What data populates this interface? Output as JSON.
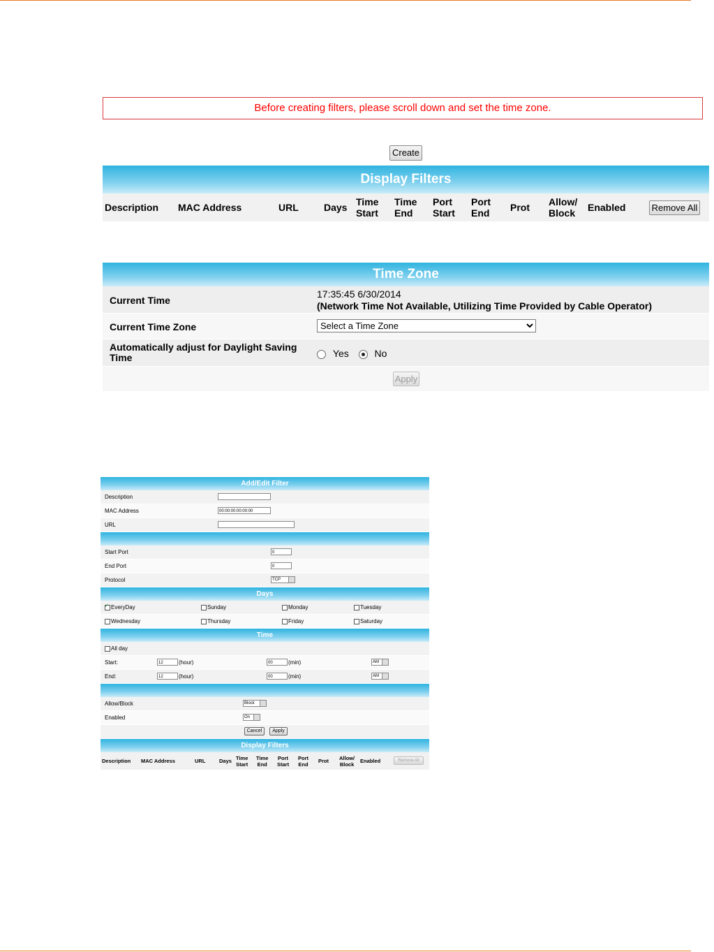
{
  "warning": "Before creating filters, please scroll down and set the time zone.",
  "create_label": "Create",
  "display_filters": {
    "title": "Display Filters",
    "columns": [
      {
        "l1": "Description",
        "l2": ""
      },
      {
        "l1": "MAC Address",
        "l2": ""
      },
      {
        "l1": "URL",
        "l2": ""
      },
      {
        "l1": "Days",
        "l2": ""
      },
      {
        "l1": "Time",
        "l2": "Start"
      },
      {
        "l1": "Time",
        "l2": "End"
      },
      {
        "l1": "Port",
        "l2": "Start"
      },
      {
        "l1": "Port",
        "l2": "End"
      },
      {
        "l1": "Prot",
        "l2": ""
      },
      {
        "l1": "Allow/",
        "l2": "Block"
      },
      {
        "l1": "Enabled",
        "l2": ""
      }
    ],
    "remove_all_label": "Remove All"
  },
  "time_zone": {
    "title": "Time Zone",
    "current_time_label": "Current Time",
    "current_time_value": "17:35:45 6/30/2014",
    "current_time_note": "(Network Time Not Available, Utilizing Time Provided by Cable Operator)",
    "current_zone_label": "Current Time Zone",
    "zone_select_value": "Select a Time Zone",
    "dst_label": "Automatically adjust for Daylight Saving Time",
    "dst_yes": "Yes",
    "dst_no": "No",
    "dst_selected": "No",
    "apply_label": "Apply"
  },
  "mini": {
    "add_edit_title": "Add/Edit Filter",
    "description_label": "Description",
    "mac_label": "MAC Address",
    "mac_value": "00:00:00:00:00:00",
    "url_label": "URL",
    "start_port_label": "Start Port",
    "start_port_value": "0",
    "end_port_label": "End Port",
    "end_port_value": "0",
    "protocol_label": "Protocol",
    "protocol_value": "TCP",
    "days_title": "Days",
    "days": [
      {
        "label": "EveryDay",
        "checked": true
      },
      {
        "label": "Sunday",
        "checked": false
      },
      {
        "label": "Monday",
        "checked": false
      },
      {
        "label": "Tuesday",
        "checked": false
      },
      {
        "label": "Wednesday",
        "checked": false
      },
      {
        "label": "Thursday",
        "checked": false
      },
      {
        "label": "Friday",
        "checked": false
      },
      {
        "label": "Saturday",
        "checked": false
      }
    ],
    "time_title": "Time",
    "all_day_label": "All day",
    "start_label": "Start:",
    "end_label": "End:",
    "hour_value": "12",
    "hour_unit": "(hour)",
    "min_value": "00",
    "min_unit": "(min)",
    "ampm_value": "AM",
    "allow_block_label": "Allow/Block",
    "allow_block_value": "Block",
    "enabled_label": "Enabled",
    "enabled_value": "On",
    "cancel_label": "Cancel",
    "apply_label": "Apply",
    "display_filters_title": "Display Filters",
    "df_columns": [
      {
        "l1": "Description",
        "l2": ""
      },
      {
        "l1": "MAC Address",
        "l2": ""
      },
      {
        "l1": "URL",
        "l2": ""
      },
      {
        "l1": "Days",
        "l2": ""
      },
      {
        "l1": "Time",
        "l2": "Start"
      },
      {
        "l1": "Time",
        "l2": "End"
      },
      {
        "l1": "Port",
        "l2": "Start"
      },
      {
        "l1": "Port",
        "l2": "End"
      },
      {
        "l1": "Prot",
        "l2": ""
      },
      {
        "l1": "Allow/",
        "l2": "Block"
      },
      {
        "l1": "Enabled",
        "l2": ""
      }
    ],
    "remove_all_label": "Remove All"
  },
  "colors": {
    "accent_rule": "#e87722",
    "warning_text": "#ff0000",
    "header_blue": "#30b4e0"
  }
}
